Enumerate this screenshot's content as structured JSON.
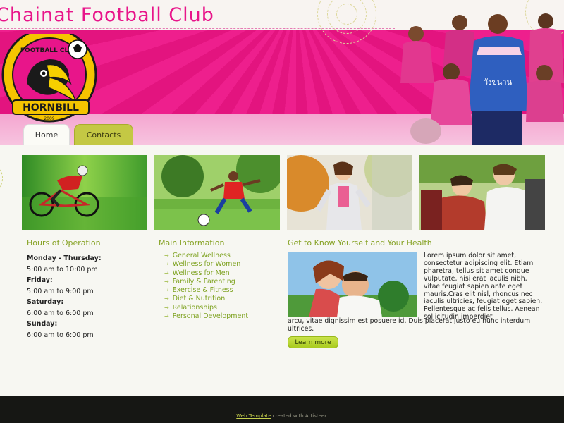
{
  "site": {
    "title": "Chainat Football Club"
  },
  "logo": {
    "top_text": "FOOTBALL CLUB",
    "bottom_text": "HORNBILL",
    "year": "2009"
  },
  "players": {
    "jersey_text": "วังขนาน"
  },
  "nav": {
    "tabs": [
      {
        "label": "Home",
        "active": true
      },
      {
        "label": "Contacts",
        "active": false
      }
    ]
  },
  "photos": [
    {
      "name": "cyclist"
    },
    {
      "name": "soccer-kid"
    },
    {
      "name": "jogger"
    },
    {
      "name": "hikers"
    }
  ],
  "hours": {
    "title": "Hours of Operation",
    "entries": [
      {
        "day": "Monday - Thursday:",
        "time": "5:00 am to 10:00 pm"
      },
      {
        "day": "Friday:",
        "time": "5:00 am to 9:00 pm"
      },
      {
        "day": "Saturday:",
        "time": "6:00 am to 6:00 pm"
      },
      {
        "day": "Sunday:",
        "time": "6:00 am to 6:00 pm"
      }
    ]
  },
  "main_info": {
    "title": "Main Information",
    "items": [
      "General Wellness",
      "Wellness for Women",
      "Wellness for Men",
      "Family & Parenting",
      "Exercise & Fitness",
      "Diet & Nutrition",
      "Relationships",
      "Personal Development"
    ]
  },
  "know": {
    "title": "Get to Know Yourself and Your Health",
    "text_side": "Lorem ipsum dolor sit amet, consectetur adipiscing elit. Etiam pharetra, tellus sit amet congue vulputate, nisi erat iaculis nibh, vitae feugiat sapien ante eget mauris.Cras elit nisl, rhoncus nec iaculis ultricies, feugiat eget sapien. Pellentesque ac felis tellus. Aenean sollicitudin imperdiet",
    "text_bottom": "arcu, vitae dignissim est posuere id. Duis placerat justo eu nunc interdum ultrices.",
    "button": "Learn more"
  },
  "footer": {
    "link": "Web Template",
    "text": " created with Artisteer."
  },
  "colors": {
    "brand_pink": "#e8158a",
    "accent_green": "#86a224",
    "button_green": "#b4d52c",
    "footer_bg": "#161714"
  }
}
